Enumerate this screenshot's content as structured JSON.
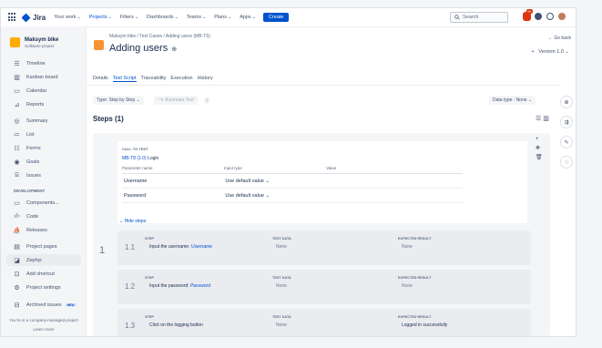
{
  "topnav": {
    "logo": "Jira",
    "items": [
      {
        "label": "Your work",
        "active": false
      },
      {
        "label": "Projects",
        "active": true
      },
      {
        "label": "Filters",
        "active": false
      },
      {
        "label": "Dashboards",
        "active": false
      },
      {
        "label": "Teams",
        "active": false
      },
      {
        "label": "Plans",
        "active": false
      },
      {
        "label": "Apps",
        "active": false
      }
    ],
    "create_label": "Create",
    "search_placeholder": "Search",
    "notification_count": "9+"
  },
  "sidebar": {
    "project_name": "Maksym bike",
    "project_type": "Software project",
    "items": [
      {
        "label": "Timeline",
        "icon": "timeline-icon"
      },
      {
        "label": "Kanban board",
        "icon": "board-icon"
      },
      {
        "label": "Calendar",
        "icon": "calendar-icon"
      },
      {
        "label": "Reports",
        "icon": "reports-icon"
      },
      {
        "label": "Summary",
        "icon": "summary-icon"
      },
      {
        "label": "List",
        "icon": "list-icon"
      },
      {
        "label": "Forms",
        "icon": "forms-icon"
      },
      {
        "label": "Goals",
        "icon": "goals-icon"
      },
      {
        "label": "Issues",
        "icon": "issues-icon"
      }
    ],
    "section_heading": "DEVELOPMENT",
    "dev_items": [
      {
        "label": "Components...",
        "icon": "components-icon"
      },
      {
        "label": "Code",
        "icon": "code-icon"
      },
      {
        "label": "Releases",
        "icon": "releases-icon"
      }
    ],
    "bottom_items": [
      {
        "label": "Project pages",
        "icon": "pages-icon"
      },
      {
        "label": "Zephyr",
        "icon": "zephyr-icon"
      },
      {
        "label": "Add shortcut",
        "icon": "add-shortcut-icon"
      },
      {
        "label": "Project settings",
        "icon": "settings-icon"
      },
      {
        "label": "Archived issues",
        "icon": "archive-icon",
        "badge": "NEW"
      }
    ],
    "footer_text": "You're in a company-managed project",
    "footer_link": "Learn more"
  },
  "page": {
    "breadcrumb": "Maksym bike  /  Test Cases  /  Adding users (MB-T6)",
    "title": "Adding users",
    "go_back": "← Go back",
    "version": "Version 1.0",
    "tabs": [
      {
        "label": "Details",
        "active": false
      },
      {
        "label": "Test Script",
        "active": true
      },
      {
        "label": "Traceability",
        "active": false
      },
      {
        "label": "Execution",
        "active": false
      },
      {
        "label": "History",
        "active": false
      }
    ],
    "type_select": "Type: Step by Step",
    "automate_label": "Automate Test",
    "data_type_select": "Data type : None",
    "steps_title": "Steps (1)"
  },
  "call_to_test": {
    "label": "CALL TO TEST",
    "link_key": "MB-T8 (1.0)",
    "link_name": "Login",
    "headers": [
      "Parameter name",
      "Input type",
      "Value"
    ],
    "rows": [
      {
        "name": "Username",
        "input_type": "Use default value"
      },
      {
        "name": "Password",
        "input_type": "Use default value"
      }
    ],
    "hide_steps": "Hide steps",
    "outer_step_number": "1"
  },
  "steps": [
    {
      "number": "1.1",
      "step_label": "STEP",
      "step_text": "Input the username:",
      "step_param": "Username",
      "data_label": "TEST DATA",
      "data": "None",
      "result_label": "EXPECTED RESULT",
      "result": "None"
    },
    {
      "number": "1.2",
      "step_label": "STEP",
      "step_text": "Input the password:",
      "step_param": "Password",
      "data_label": "TEST DATA",
      "data": "None",
      "result_label": "EXPECTED RESULT",
      "result": "None"
    },
    {
      "number": "1.3",
      "step_label": "STEP",
      "step_text": "Click on the logging button",
      "step_param": "",
      "data_label": "TEST DATA",
      "data": "None",
      "result_label": "EXPECTED RESULT",
      "result": "Logged in successfully"
    }
  ]
}
